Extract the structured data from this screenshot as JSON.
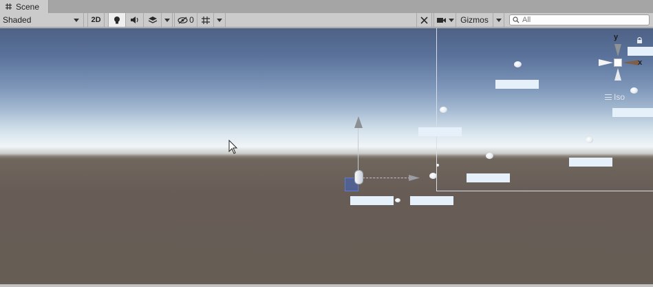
{
  "tab": {
    "label": "Scene",
    "icon": "hash-grid-icon"
  },
  "toolbar": {
    "draw_mode": "Shaded",
    "mode_2d": "2D",
    "hidden_count": "0",
    "gizmos_label": "Gizmos"
  },
  "search": {
    "placeholder": "All",
    "value": ""
  },
  "gizmo": {
    "y_label": "y",
    "x_label": "x",
    "projection": "Iso"
  },
  "colors": {
    "sky_top": "#4e6185",
    "horizon": "#f1f5f8",
    "ground": "#665d55",
    "selection": "#4062be"
  }
}
